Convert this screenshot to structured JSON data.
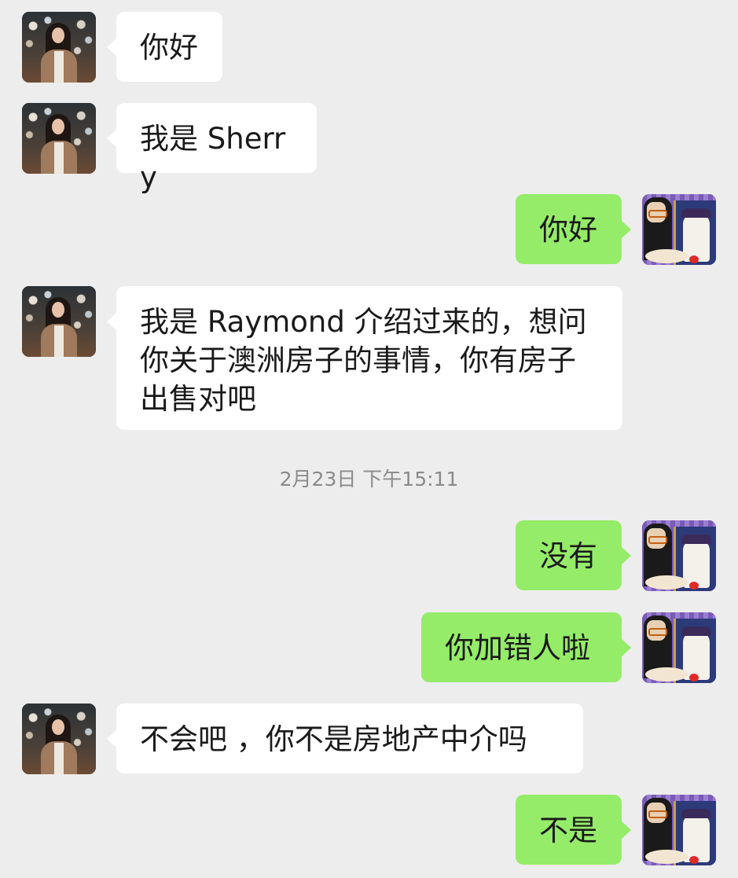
{
  "conversation": {
    "timestamp": "2月23日 下午15:11",
    "messages": [
      {
        "sender": "Sherry",
        "side": "left",
        "text": "你好"
      },
      {
        "sender": "Sherry",
        "side": "left",
        "text": "我是 Sherry"
      },
      {
        "sender": "me",
        "side": "right",
        "text": "你好"
      },
      {
        "sender": "Sherry",
        "side": "left",
        "text": "我是 Raymond 介绍过来的，想问\n你关于澳洲房子的事情，你有房子\n出售对吧"
      },
      {
        "sender": "me",
        "side": "right",
        "text": "没有"
      },
      {
        "sender": "me",
        "side": "right",
        "text": "你加错人啦"
      },
      {
        "sender": "Sherry",
        "side": "left",
        "text": "不会吧 ，你不是房地产中介吗"
      },
      {
        "sender": "me",
        "side": "right",
        "text": "不是"
      }
    ]
  },
  "colors": {
    "background": "#ededed",
    "incoming_bubble": "#ffffff",
    "outgoing_bubble": "#95ec69",
    "timestamp_text": "#8a8a8a"
  },
  "icons": {
    "contact_avatar": "contact-avatar-photo",
    "own_avatar": "own-avatar-cartoon"
  }
}
